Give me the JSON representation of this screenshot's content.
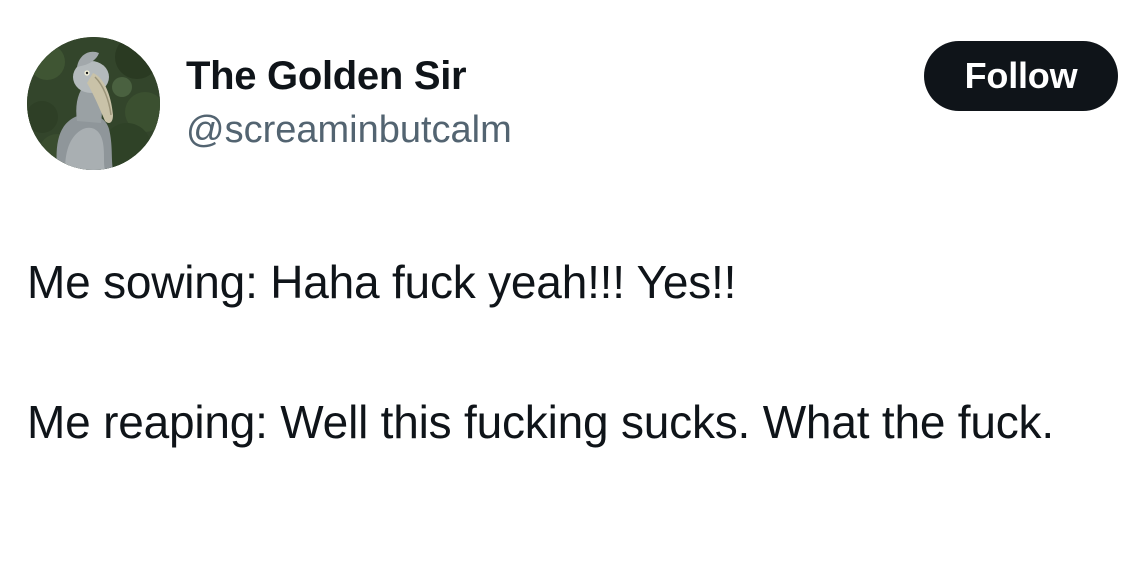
{
  "author": {
    "display_name": "The Golden Sir",
    "handle": "@screaminbutcalm",
    "avatar_icon": "shoebill-bird-avatar"
  },
  "follow_button": {
    "label": "Follow"
  },
  "tweet": {
    "paragraphs": [
      "Me sowing: Haha fuck yeah!!! Yes!!",
      "Me reaping: Well this fucking sucks. What the fuck."
    ]
  },
  "colors": {
    "text_primary": "#0f1419",
    "text_secondary": "#536471",
    "button_bg": "#0f1419",
    "button_text": "#ffffff",
    "background": "#ffffff"
  }
}
